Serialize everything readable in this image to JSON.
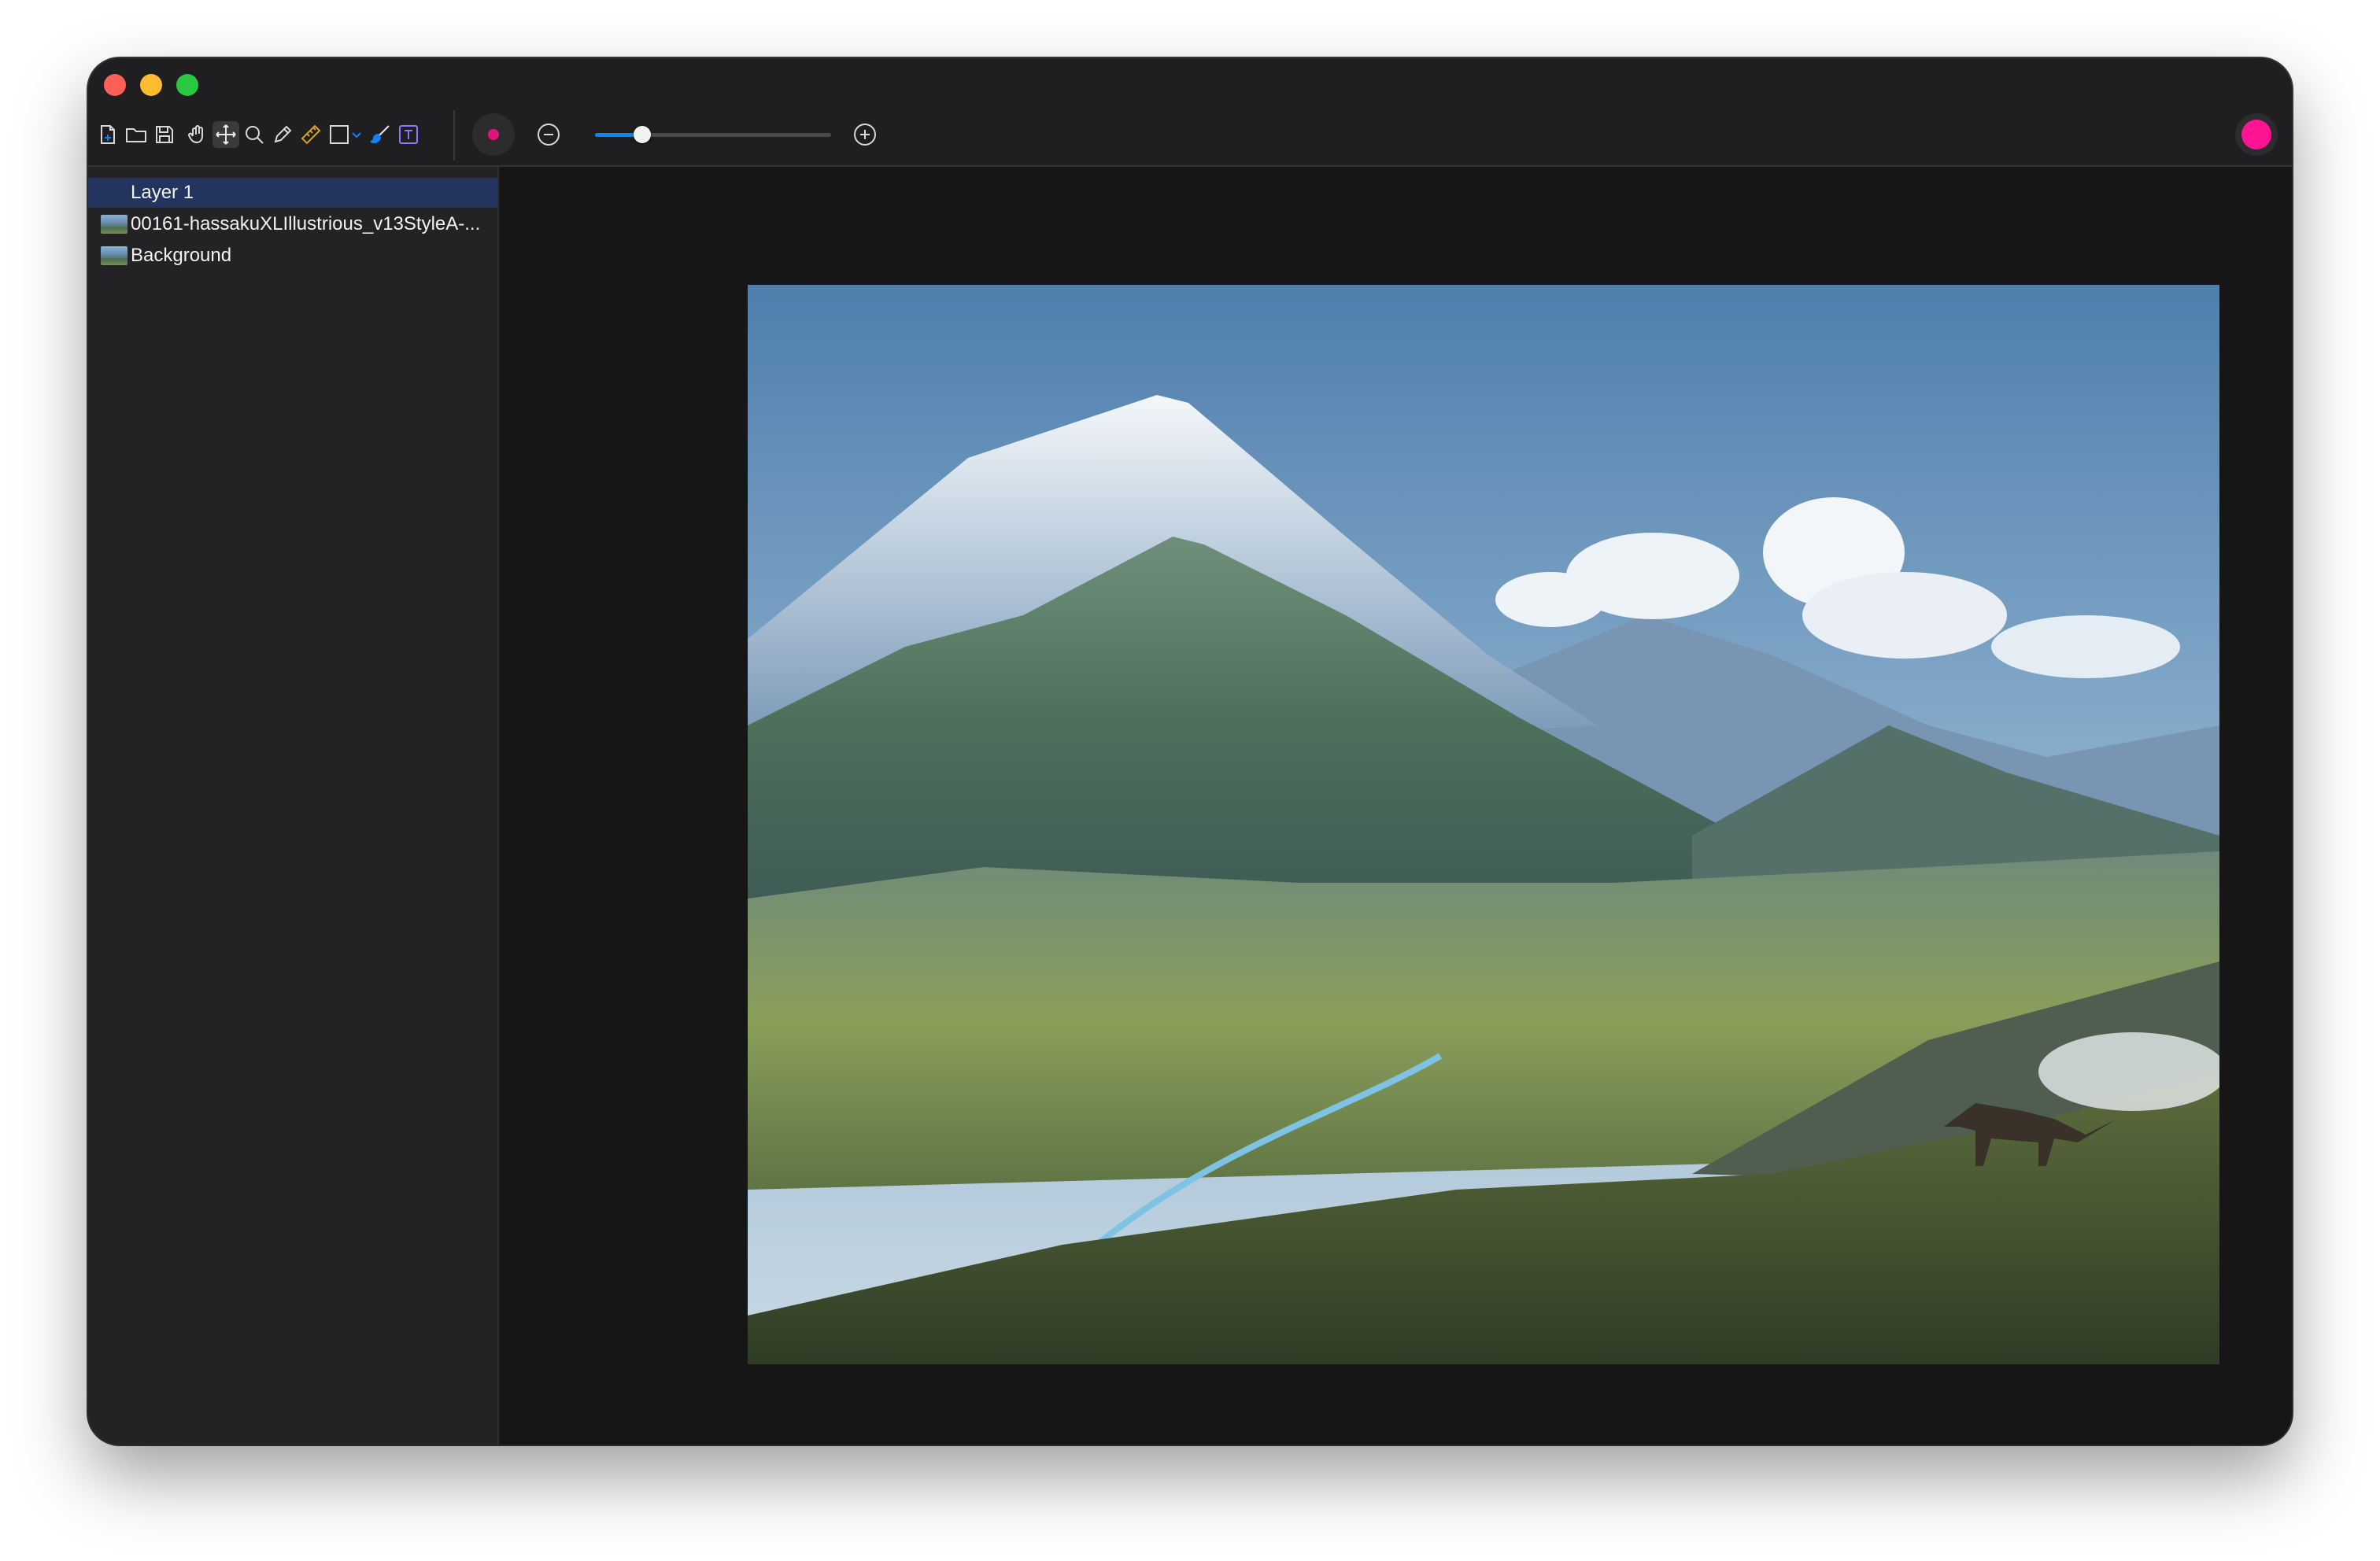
{
  "toolbar": {
    "tools": [
      {
        "name": "new-document"
      },
      {
        "name": "open-folder"
      },
      {
        "name": "save"
      },
      {
        "name": "hand"
      },
      {
        "name": "move"
      },
      {
        "name": "zoom"
      },
      {
        "name": "pencil"
      },
      {
        "name": "ruler"
      },
      {
        "name": "rectangle-select"
      },
      {
        "name": "brush"
      },
      {
        "name": "text"
      }
    ],
    "active_tool": "move",
    "zoom_slider_value_percent": 20,
    "colors": {
      "accent": "#0a84ff",
      "record": "#e0147f",
      "current_color": "#ff1493",
      "ruler": "#d6a42a",
      "text_tool": "#8c78ff"
    }
  },
  "layers": {
    "items": [
      {
        "label": "Layer 1",
        "selected": true,
        "thumbnail": false
      },
      {
        "label": "00161-hassakuXLIllustrious_v13StyleA-...",
        "selected": false,
        "thumbnail": true
      },
      {
        "label": "Background",
        "selected": false,
        "thumbnail": true
      }
    ]
  }
}
